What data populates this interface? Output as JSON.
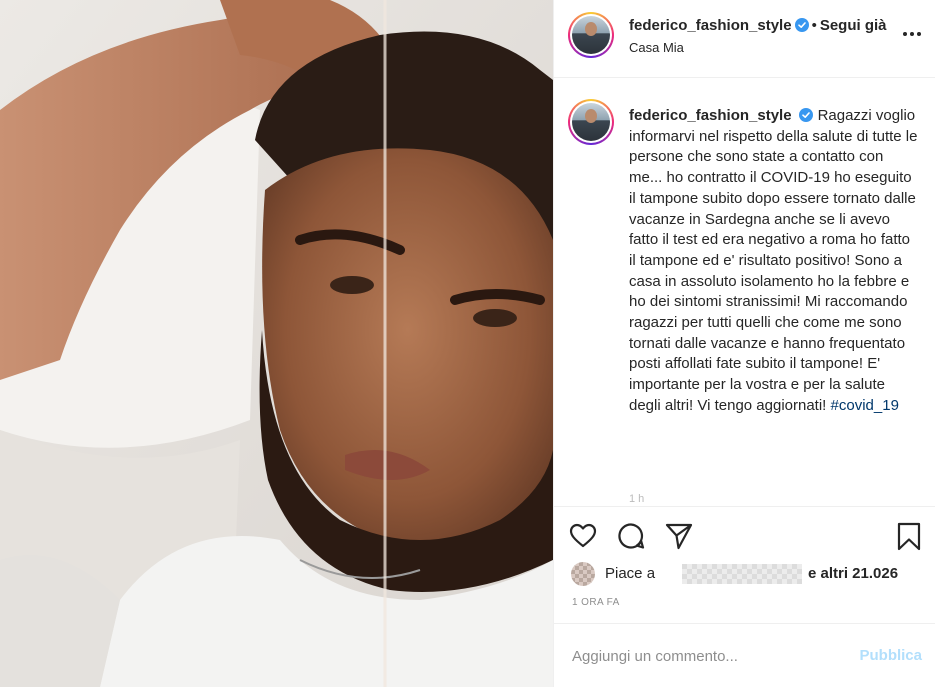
{
  "post": {
    "username": "federico_fashion_style",
    "verified": true,
    "follow_status": "Segui già",
    "separator": "•",
    "location": "Casa Mia",
    "more_options_icon": "ellipsis-icon"
  },
  "caption": {
    "text": "Ragazzi voglio informarvi nel rispetto della salute di tutte le persone che sono state a contatto con me... ho contratto il COVID-19 ho eseguito il tampone subito dopo essere tornato dalle vacanze in Sardegna anche se li avevo fatto il test ed era negativo a roma ho fatto il tampone ed e' risultato positivo! Sono a casa in assoluto isolamento ho la febbre e ho dei sintomi stranissimi! Mi raccomando ragazzi per tutti quelli che come me sono tornati dalle vacanze e hanno frequentato posti affollati fate subito il tampone! E' importante per la vostra e per la salute degli altri! Vi tengo aggiornati!",
    "hashtag": "#covid_19",
    "partial_timestamp": "1 h"
  },
  "actions": {
    "icons": [
      "heart-icon",
      "comment-icon",
      "share-icon",
      "bookmark-icon"
    ]
  },
  "likes": {
    "prefix": "Piace a",
    "suffix": "e altri 21.026"
  },
  "timestamp": "1 ORA FA",
  "comment": {
    "placeholder": "Aggiungi un commento...",
    "publish_label": "Pubblica"
  },
  "colors": {
    "verified_blue": "#3897f0",
    "link_blue": "#00376b",
    "publish_disabled": "#b2dffc",
    "border": "#efefef"
  }
}
